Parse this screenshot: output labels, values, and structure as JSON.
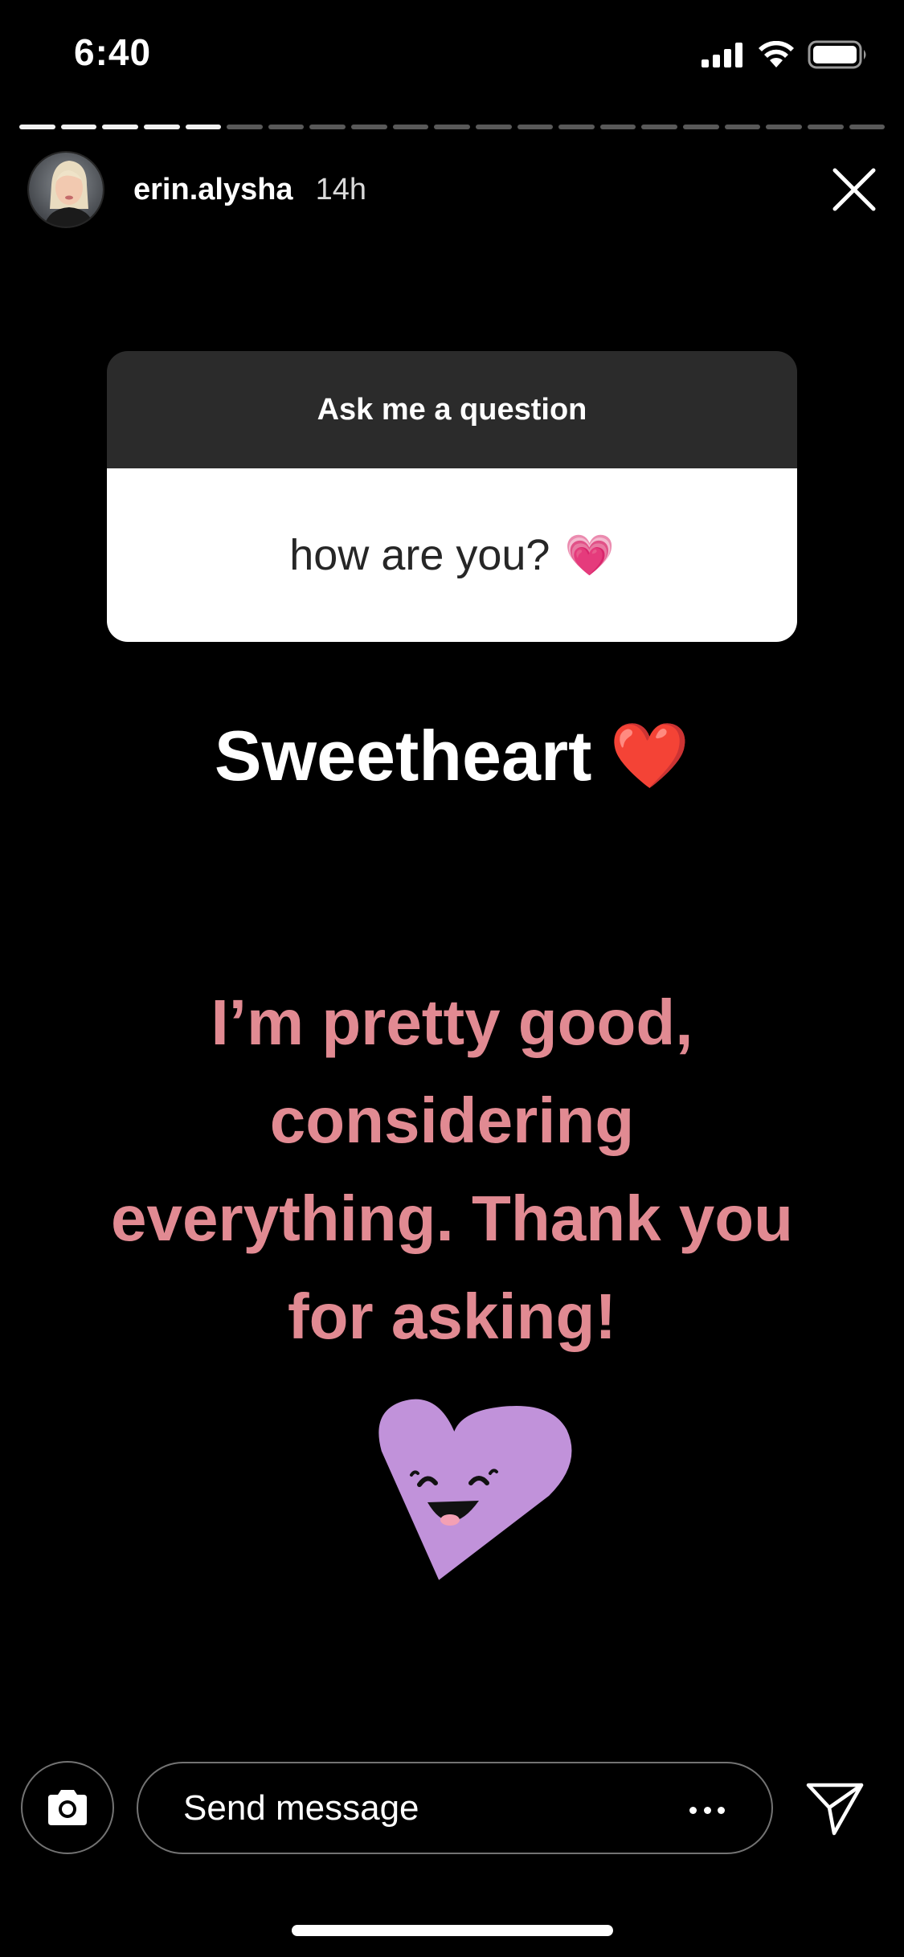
{
  "status_bar": {
    "time": "6:40",
    "icons": [
      "cellular-signal-icon",
      "wifi-icon",
      "battery-icon"
    ]
  },
  "story": {
    "segments_total": 21,
    "segments_viewed": 5,
    "username": "erin.alysha",
    "time_ago": "14h",
    "close_icon": "close-icon"
  },
  "question_sticker": {
    "title": "Ask me a question",
    "question": "how are you?",
    "question_emoji": "💗"
  },
  "caption": {
    "text": "Sweetheart",
    "emoji": "❤️"
  },
  "answer": {
    "lines": [
      "I’m pretty good,",
      "considering",
      "everything. Thank you",
      "for asking!"
    ]
  },
  "sticker": {
    "name": "smiling-heart-sticker",
    "color": "#c192da"
  },
  "reply_bar": {
    "camera_icon": "camera-icon",
    "placeholder": "Send message",
    "more_icon": "more-dots-icon",
    "send_icon": "send-icon"
  },
  "colors": {
    "background": "#000000",
    "answer_text": "#e18a92",
    "card_header": "#2b2b2b",
    "card_body": "#ffffff"
  }
}
